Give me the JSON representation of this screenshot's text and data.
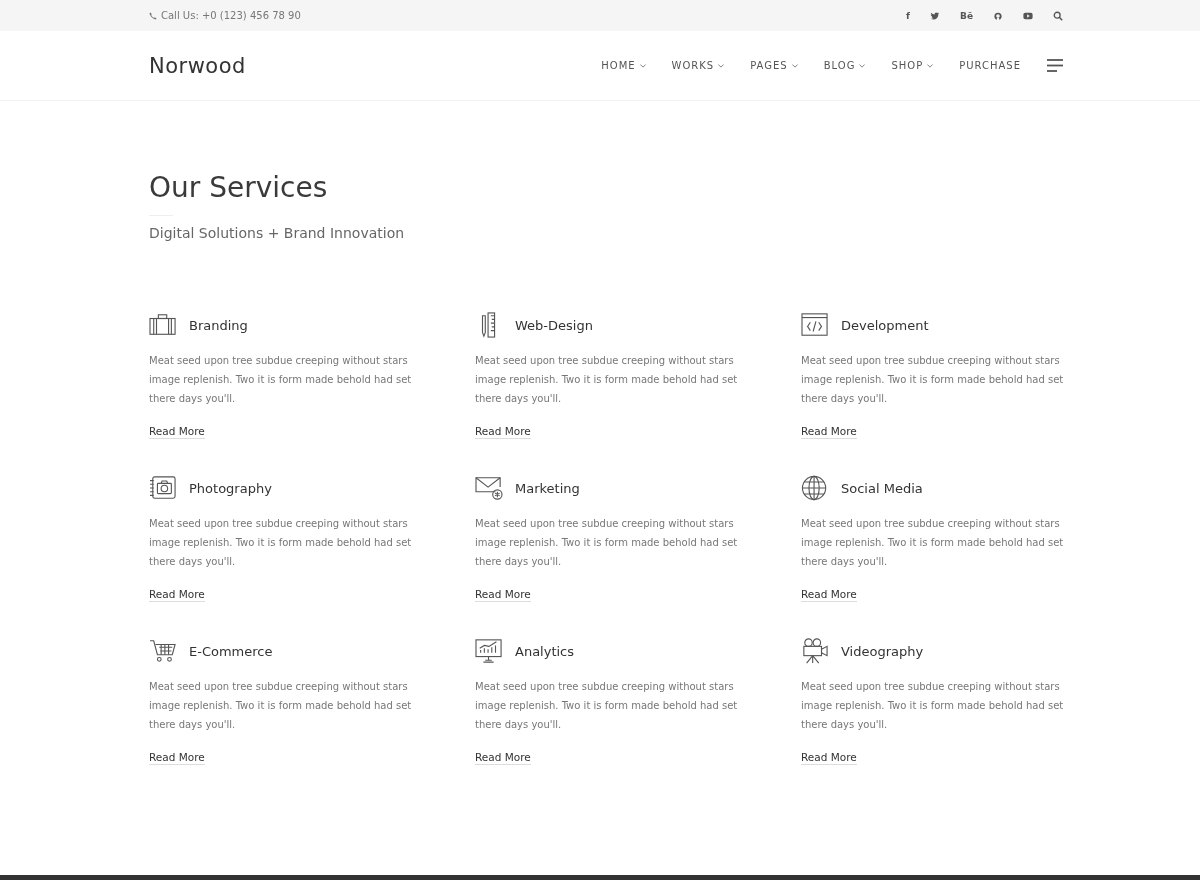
{
  "topbar": {
    "phone": "Call Us: +0 (123) 456 78 90",
    "social": [
      {
        "kind": "text",
        "text": "f"
      },
      {
        "kind": "twitter"
      },
      {
        "kind": "text",
        "text": "Bē"
      },
      {
        "kind": "github"
      },
      {
        "kind": "youtube"
      },
      {
        "kind": "search"
      }
    ]
  },
  "header": {
    "logo": "Norwood",
    "nav": [
      {
        "label": "HOME",
        "dropdown": true
      },
      {
        "label": "WORKS",
        "dropdown": true
      },
      {
        "label": "PAGES",
        "dropdown": true
      },
      {
        "label": "BLOG",
        "dropdown": true
      },
      {
        "label": "SHOP",
        "dropdown": true
      },
      {
        "label": "PURCHASE",
        "dropdown": false
      }
    ]
  },
  "section": {
    "title": "Our Services",
    "subtitle": "Digital Solutions + Brand Innovation"
  },
  "services": [
    {
      "kind": "briefcase",
      "title": "Branding",
      "text": "Meat seed upon tree subdue creeping without stars image replenish. Two it is form made behold had set there days you'll.",
      "link": "Read More"
    },
    {
      "kind": "ruler",
      "title": "Web-Design",
      "text": "Meat seed upon tree subdue creeping without stars image replenish. Two it is form made behold had set there days you'll.",
      "link": "Read More"
    },
    {
      "kind": "code",
      "title": "Development",
      "text": "Meat seed upon tree subdue creeping without stars image replenish. Two it is form made behold had set there days you'll.",
      "link": "Read More"
    },
    {
      "kind": "camera",
      "title": "Photography",
      "text": "Meat seed upon tree subdue creeping without stars image replenish. Two it is form made behold had set there days you'll.",
      "link": "Read More"
    },
    {
      "kind": "envelope",
      "title": "Marketing",
      "text": "Meat seed upon tree subdue creeping without stars image replenish. Two it is form made behold had set there days you'll.",
      "link": "Read More"
    },
    {
      "kind": "globe",
      "title": "Social Media",
      "text": "Meat seed upon tree subdue creeping without stars image replenish. Two it is form made behold had set there days you'll.",
      "link": "Read More"
    },
    {
      "kind": "cart",
      "title": "E-Commerce",
      "text": "Meat seed upon tree subdue creeping without stars image replenish. Two it is form made behold had set there days you'll.",
      "link": "Read More"
    },
    {
      "kind": "chart",
      "title": "Analytics",
      "text": "Meat seed upon tree subdue creeping without stars image replenish. Two it is form made behold had set there days you'll.",
      "link": "Read More"
    },
    {
      "kind": "film",
      "title": "Videography",
      "text": "Meat seed upon tree subdue creeping without stars image replenish. Two it is form made behold had set there days you'll.",
      "link": "Read More"
    }
  ]
}
